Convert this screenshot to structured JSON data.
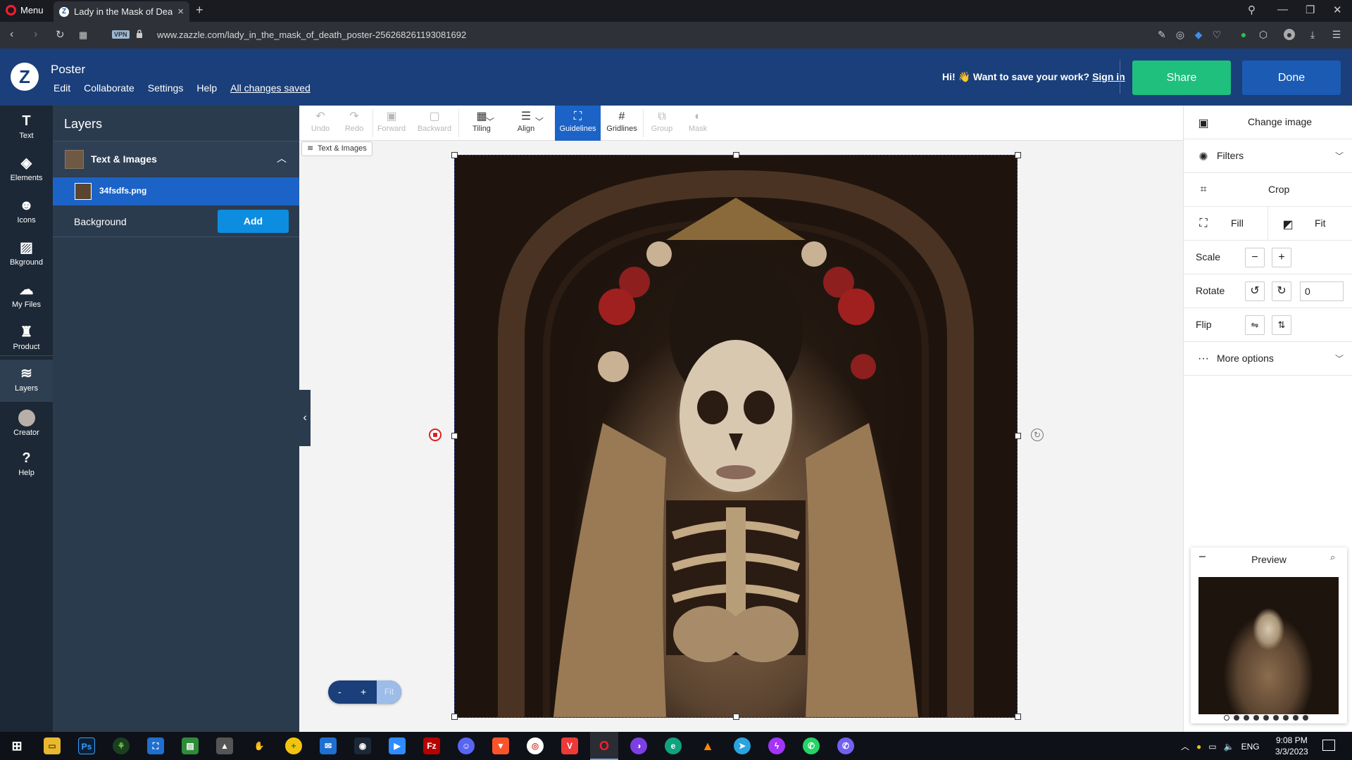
{
  "browser": {
    "menu_label": "Menu",
    "tab_title": "Lady in the Mask of Death",
    "url": "www.zazzle.com/lady_in_the_mask_of_death_poster-256268261193081692",
    "vpn_label": "VPN"
  },
  "header": {
    "logo_letter": "Z",
    "product_title": "Poster",
    "menu": [
      "Edit",
      "Collaborate",
      "Settings",
      "Help"
    ],
    "save_status": "All changes saved",
    "save_prompt": "Hi! 👋 Want to save your work?",
    "sign_in": "Sign in",
    "share_label": "Share",
    "done_label": "Done",
    "brand_color": "#1a3f7a",
    "share_color": "#1fbf7e"
  },
  "rail": {
    "items": [
      {
        "label": "Text",
        "icon": "text-icon"
      },
      {
        "label": "Elements",
        "icon": "elements-icon"
      },
      {
        "label": "Icons",
        "icon": "smiley-icon"
      },
      {
        "label": "Bkground",
        "icon": "background-icon"
      },
      {
        "label": "My Files",
        "icon": "cloud-upload-icon"
      },
      {
        "label": "Product",
        "icon": "product-icon"
      },
      {
        "label": "Layers",
        "icon": "layers-icon"
      },
      {
        "label": "Creator",
        "icon": "creator-avatar"
      },
      {
        "label": "Help",
        "icon": "help-icon"
      }
    ],
    "active": "Layers"
  },
  "layers": {
    "title": "Layers",
    "group_label": "Text & Images",
    "file_label": "34fsdfs.png",
    "background_label": "Background",
    "add_label": "Add"
  },
  "toolbar": {
    "tools": [
      {
        "label": "Undo",
        "enabled": false
      },
      {
        "label": "Redo",
        "enabled": false
      },
      {
        "label": "Forward",
        "enabled": false
      },
      {
        "label": "Backward",
        "enabled": false
      },
      {
        "label": "Tiling",
        "enabled": true
      },
      {
        "label": "Align",
        "enabled": true
      },
      {
        "label": "Guidelines",
        "enabled": true,
        "active": true
      },
      {
        "label": "Gridlines",
        "enabled": true
      },
      {
        "label": "Group",
        "enabled": false
      },
      {
        "label": "Mask",
        "enabled": false
      }
    ],
    "layer_chip": "Text & Images"
  },
  "zoom": {
    "minus": "-",
    "plus": "+",
    "fit": "Fit"
  },
  "props": {
    "change_image": "Change image",
    "filters": "Filters",
    "crop": "Crop",
    "fill": "Fill",
    "fit": "Fit",
    "scale": "Scale",
    "rotate": "Rotate",
    "rotate_value": "0",
    "flip": "Flip",
    "more_options": "More options"
  },
  "preview": {
    "title": "Preview",
    "pages": 9,
    "current_page": 1
  },
  "taskbar": {
    "lang": "ENG",
    "time": "9:08 PM",
    "date": "3/3/2023"
  }
}
